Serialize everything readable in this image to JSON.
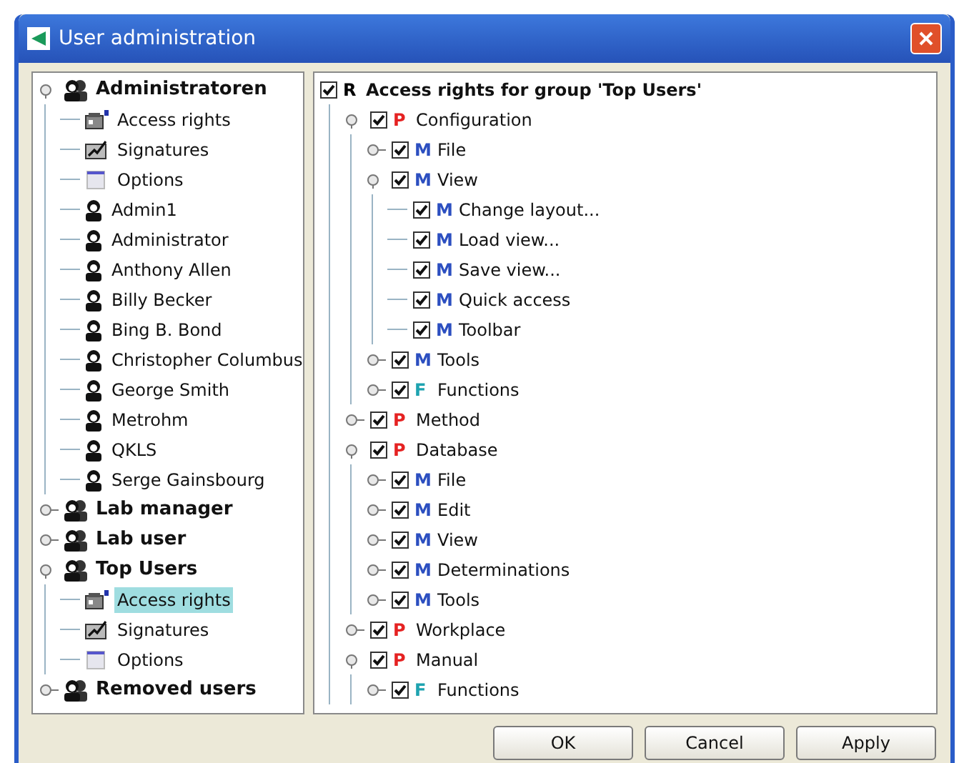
{
  "window": {
    "title": "User administration"
  },
  "user_tree": [
    {
      "kind": "group",
      "label": "Administratoren",
      "expanded": true,
      "selected": false,
      "children": [
        {
          "kind": "access",
          "label": "Access rights",
          "selected": false
        },
        {
          "kind": "signatures",
          "label": "Signatures",
          "selected": false
        },
        {
          "kind": "options",
          "label": "Options",
          "selected": false
        },
        {
          "kind": "user",
          "label": "Admin1",
          "selected": false
        },
        {
          "kind": "user",
          "label": "Administrator",
          "selected": false
        },
        {
          "kind": "user",
          "label": "Anthony Allen",
          "selected": false
        },
        {
          "kind": "user",
          "label": "Billy Becker",
          "selected": false
        },
        {
          "kind": "user",
          "label": "Bing B. Bond",
          "selected": false
        },
        {
          "kind": "user",
          "label": "Christopher Columbus",
          "selected": false
        },
        {
          "kind": "user",
          "label": "George Smith",
          "selected": false
        },
        {
          "kind": "user",
          "label": "Metrohm",
          "selected": false
        },
        {
          "kind": "user",
          "label": "QKLS",
          "selected": false
        },
        {
          "kind": "user",
          "label": "Serge Gainsbourg",
          "selected": false
        }
      ]
    },
    {
      "kind": "group",
      "label": "Lab manager",
      "expanded": false,
      "selected": false
    },
    {
      "kind": "group",
      "label": "Lab user",
      "expanded": false,
      "selected": false
    },
    {
      "kind": "group",
      "label": "Top Users",
      "expanded": true,
      "selected": false,
      "children": [
        {
          "kind": "access",
          "label": "Access rights",
          "selected": true
        },
        {
          "kind": "signatures",
          "label": "Signatures",
          "selected": false
        },
        {
          "kind": "options",
          "label": "Options",
          "selected": false
        }
      ]
    },
    {
      "kind": "group",
      "label": "Removed users",
      "expanded": false,
      "selected": false
    }
  ],
  "rights_tree": {
    "kind": "rights",
    "letter": "R",
    "label": "Access rights for group 'Top Users'",
    "checked": true,
    "children": [
      {
        "kind": "program",
        "letter": "P",
        "label": "Configuration",
        "checked": true,
        "expanded": true,
        "children": [
          {
            "kind": "menu",
            "letter": "M",
            "label": "File",
            "checked": true,
            "expanded": false
          },
          {
            "kind": "menu",
            "letter": "M",
            "label": "View",
            "checked": true,
            "expanded": true,
            "children": [
              {
                "kind": "menu",
                "letter": "M",
                "label": "Change layout...",
                "checked": true
              },
              {
                "kind": "menu",
                "letter": "M",
                "label": "Load view...",
                "checked": true
              },
              {
                "kind": "menu",
                "letter": "M",
                "label": "Save view...",
                "checked": true
              },
              {
                "kind": "menu",
                "letter": "M",
                "label": "Quick access",
                "checked": true
              },
              {
                "kind": "menu",
                "letter": "M",
                "label": "Toolbar",
                "checked": true
              }
            ]
          },
          {
            "kind": "menu",
            "letter": "M",
            "label": "Tools",
            "checked": true,
            "expanded": false
          },
          {
            "kind": "function",
            "letter": "F",
            "label": "Functions",
            "checked": true,
            "expanded": false
          }
        ]
      },
      {
        "kind": "program",
        "letter": "P",
        "label": "Method",
        "checked": true,
        "expanded": false
      },
      {
        "kind": "program",
        "letter": "P",
        "label": "Database",
        "checked": true,
        "expanded": true,
        "children": [
          {
            "kind": "menu",
            "letter": "M",
            "label": "File",
            "checked": true,
            "expanded": false
          },
          {
            "kind": "menu",
            "letter": "M",
            "label": "Edit",
            "checked": true,
            "expanded": false
          },
          {
            "kind": "menu",
            "letter": "M",
            "label": "View",
            "checked": true,
            "expanded": false
          },
          {
            "kind": "menu",
            "letter": "M",
            "label": "Determinations",
            "checked": true,
            "expanded": false
          },
          {
            "kind": "menu",
            "letter": "M",
            "label": "Tools",
            "checked": true,
            "expanded": false
          }
        ]
      },
      {
        "kind": "program",
        "letter": "P",
        "label": "Workplace",
        "checked": true,
        "expanded": false
      },
      {
        "kind": "program",
        "letter": "P",
        "label": "Manual",
        "checked": true,
        "expanded": true,
        "children": [
          {
            "kind": "function",
            "letter": "F",
            "label": "Functions",
            "checked": true,
            "expanded": false
          }
        ]
      }
    ]
  },
  "buttons": [
    "OK",
    "Cancel",
    "Apply"
  ]
}
